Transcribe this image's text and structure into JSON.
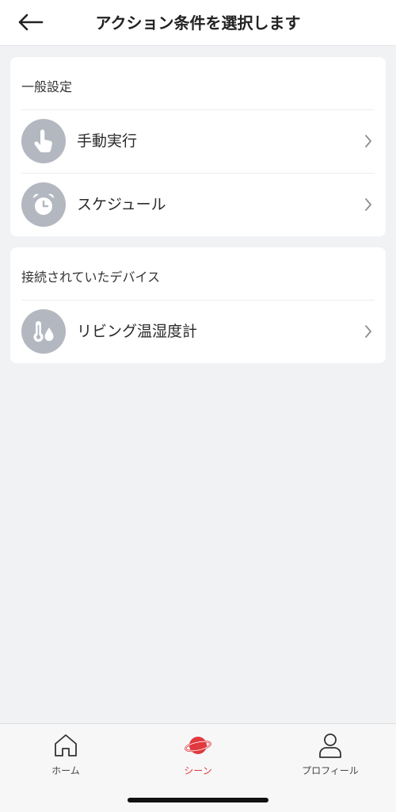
{
  "header": {
    "title": "アクション条件を選択します",
    "back_icon": "arrow-left-icon"
  },
  "general_section": {
    "label": "一般設定",
    "items": [
      {
        "label": "手動実行",
        "icon": "hand-tap-icon"
      },
      {
        "label": "スケジュール",
        "icon": "alarm-clock-icon"
      }
    ]
  },
  "devices_section": {
    "label": "接続されていたデバイス",
    "items": [
      {
        "label": "リビング温湿度計",
        "icon": "thermo-hygrometer-icon"
      }
    ]
  },
  "tabbar": {
    "tabs": [
      {
        "label": "ホーム",
        "icon": "home-icon",
        "active": false
      },
      {
        "label": "シーン",
        "icon": "scene-planet-icon",
        "active": true
      },
      {
        "label": "プロフィール",
        "icon": "profile-icon",
        "active": false
      }
    ]
  },
  "colors": {
    "accent": "#e0393e",
    "icon_circle": "#b3b7c0",
    "background": "#f1f2f4"
  }
}
